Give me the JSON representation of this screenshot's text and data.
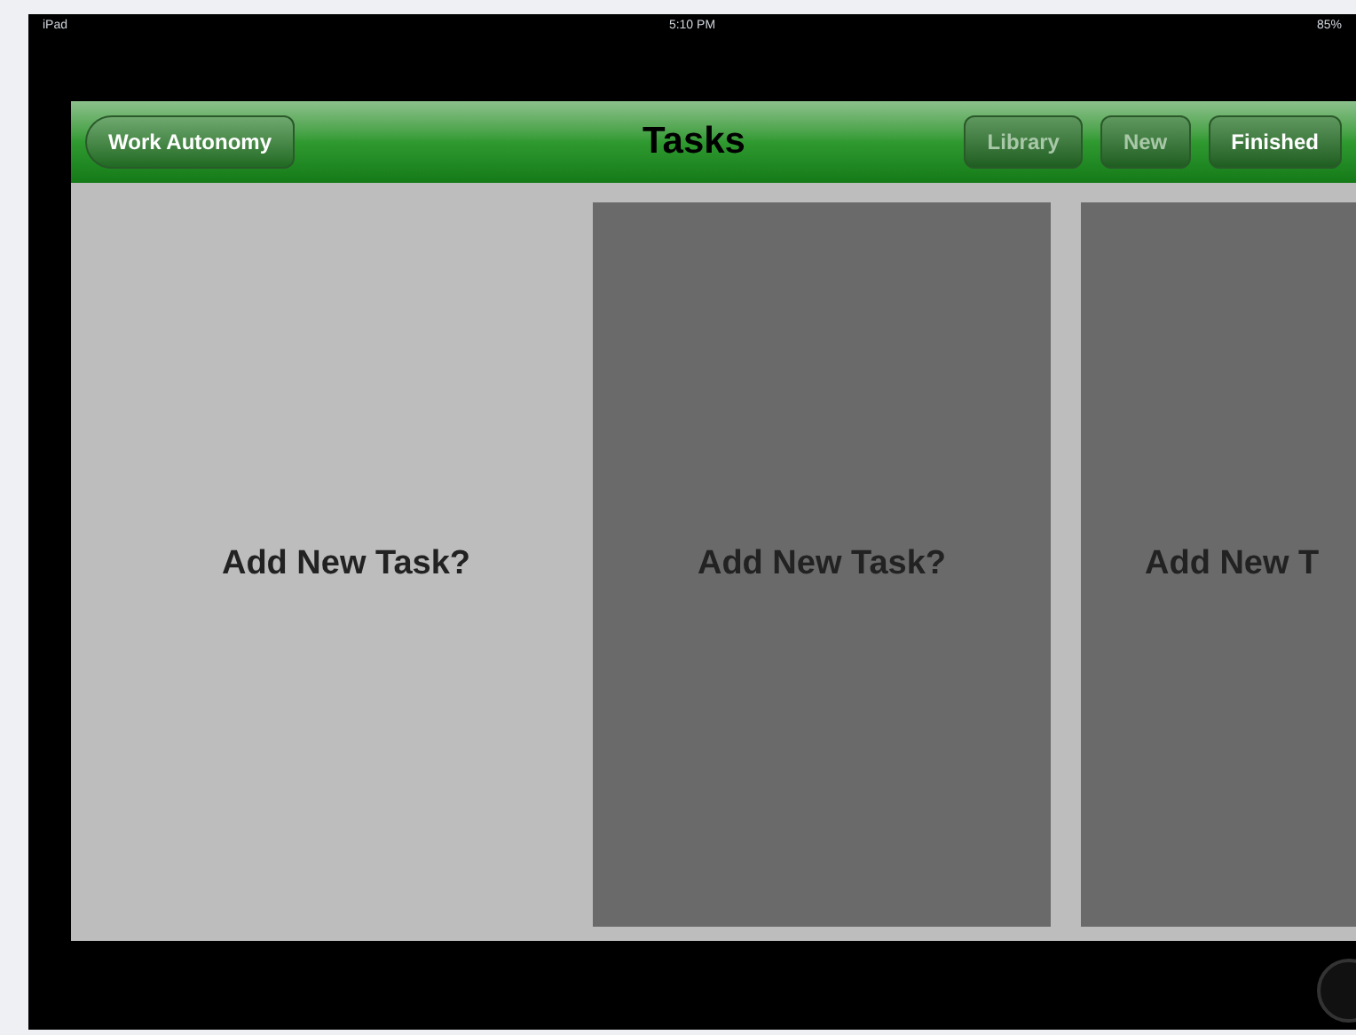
{
  "status_bar": {
    "device": "iPad",
    "time": "5:10 PM",
    "battery": "85%"
  },
  "nav_bar": {
    "back_button": "Work Autonomy",
    "title": "Tasks",
    "buttons": [
      {
        "label": "Library",
        "selected": false
      },
      {
        "label": "New",
        "selected": false
      },
      {
        "label": "Finished",
        "selected": true
      }
    ]
  },
  "task_cards": [
    {
      "label": "Add New Task?",
      "selected": true
    },
    {
      "label": "Add New Task?",
      "selected": false
    },
    {
      "label": "Add New T",
      "selected": false
    }
  ]
}
